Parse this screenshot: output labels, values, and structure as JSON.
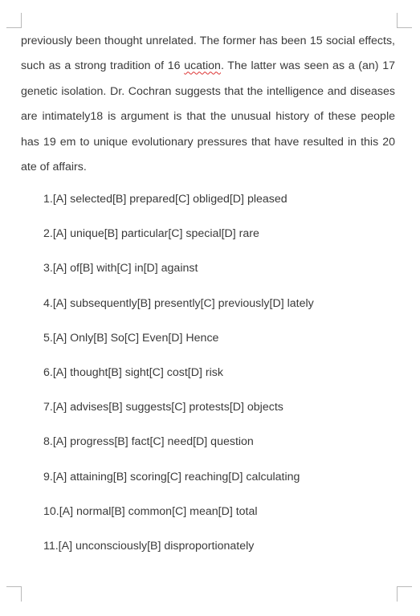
{
  "passage": {
    "before_squiggle": "previously been thought unrelated. The former has been 15 social effects, such as a strong tradition of 16 ",
    "squiggle_word": "ucation",
    "after_squiggle": ". The latter was seen as a (an) 17 genetic isolation. Dr. Cochran suggests that the intelligence and diseases are intimately18 is argument is that the unusual history of these people has 19 em to unique evolutionary pressures that have resulted in this 20 ate of affairs."
  },
  "options": [
    "1.[A] selected[B] prepared[C] obliged[D] pleased",
    "2.[A] unique[B] particular[C] special[D] rare",
    "3.[A] of[B] with[C] in[D] against",
    "4.[A] subsequently[B] presently[C] previously[D] lately",
    "5.[A] Only[B] So[C] Even[D] Hence",
    "6.[A] thought[B] sight[C] cost[D] risk",
    "7.[A] advises[B] suggests[C] protests[D] objects",
    "8.[A] progress[B] fact[C] need[D] question",
    "9.[A] attaining[B] scoring[C] reaching[D] calculating",
    "10.[A] normal[B] common[C] mean[D] total",
    "11.[A] unconsciously[B] disproportionately"
  ]
}
